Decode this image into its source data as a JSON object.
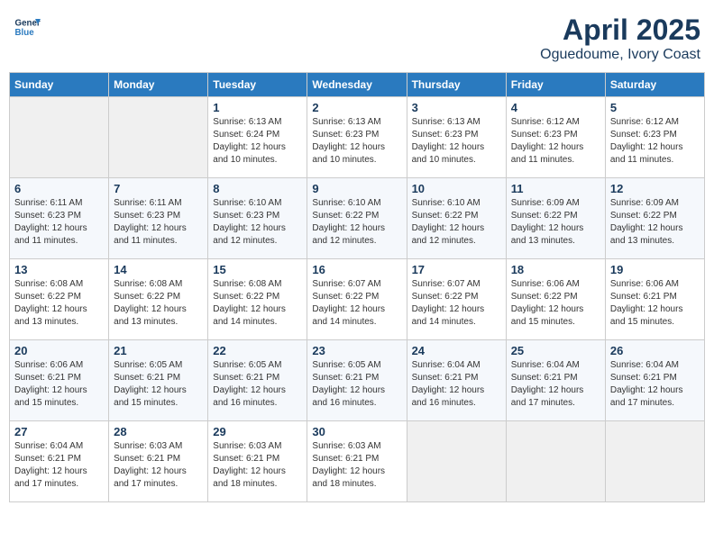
{
  "header": {
    "logo_line1": "General",
    "logo_line2": "Blue",
    "month": "April 2025",
    "location": "Oguedoume, Ivory Coast"
  },
  "weekdays": [
    "Sunday",
    "Monday",
    "Tuesday",
    "Wednesday",
    "Thursday",
    "Friday",
    "Saturday"
  ],
  "weeks": [
    [
      {
        "num": "",
        "sunrise": "",
        "sunset": "",
        "daylight": "",
        "empty": true
      },
      {
        "num": "",
        "sunrise": "",
        "sunset": "",
        "daylight": "",
        "empty": true
      },
      {
        "num": "1",
        "sunrise": "Sunrise: 6:13 AM",
        "sunset": "Sunset: 6:24 PM",
        "daylight": "Daylight: 12 hours and 10 minutes."
      },
      {
        "num": "2",
        "sunrise": "Sunrise: 6:13 AM",
        "sunset": "Sunset: 6:23 PM",
        "daylight": "Daylight: 12 hours and 10 minutes."
      },
      {
        "num": "3",
        "sunrise": "Sunrise: 6:13 AM",
        "sunset": "Sunset: 6:23 PM",
        "daylight": "Daylight: 12 hours and 10 minutes."
      },
      {
        "num": "4",
        "sunrise": "Sunrise: 6:12 AM",
        "sunset": "Sunset: 6:23 PM",
        "daylight": "Daylight: 12 hours and 11 minutes."
      },
      {
        "num": "5",
        "sunrise": "Sunrise: 6:12 AM",
        "sunset": "Sunset: 6:23 PM",
        "daylight": "Daylight: 12 hours and 11 minutes."
      }
    ],
    [
      {
        "num": "6",
        "sunrise": "Sunrise: 6:11 AM",
        "sunset": "Sunset: 6:23 PM",
        "daylight": "Daylight: 12 hours and 11 minutes."
      },
      {
        "num": "7",
        "sunrise": "Sunrise: 6:11 AM",
        "sunset": "Sunset: 6:23 PM",
        "daylight": "Daylight: 12 hours and 11 minutes."
      },
      {
        "num": "8",
        "sunrise": "Sunrise: 6:10 AM",
        "sunset": "Sunset: 6:23 PM",
        "daylight": "Daylight: 12 hours and 12 minutes."
      },
      {
        "num": "9",
        "sunrise": "Sunrise: 6:10 AM",
        "sunset": "Sunset: 6:22 PM",
        "daylight": "Daylight: 12 hours and 12 minutes."
      },
      {
        "num": "10",
        "sunrise": "Sunrise: 6:10 AM",
        "sunset": "Sunset: 6:22 PM",
        "daylight": "Daylight: 12 hours and 12 minutes."
      },
      {
        "num": "11",
        "sunrise": "Sunrise: 6:09 AM",
        "sunset": "Sunset: 6:22 PM",
        "daylight": "Daylight: 12 hours and 13 minutes."
      },
      {
        "num": "12",
        "sunrise": "Sunrise: 6:09 AM",
        "sunset": "Sunset: 6:22 PM",
        "daylight": "Daylight: 12 hours and 13 minutes."
      }
    ],
    [
      {
        "num": "13",
        "sunrise": "Sunrise: 6:08 AM",
        "sunset": "Sunset: 6:22 PM",
        "daylight": "Daylight: 12 hours and 13 minutes."
      },
      {
        "num": "14",
        "sunrise": "Sunrise: 6:08 AM",
        "sunset": "Sunset: 6:22 PM",
        "daylight": "Daylight: 12 hours and 13 minutes."
      },
      {
        "num": "15",
        "sunrise": "Sunrise: 6:08 AM",
        "sunset": "Sunset: 6:22 PM",
        "daylight": "Daylight: 12 hours and 14 minutes."
      },
      {
        "num": "16",
        "sunrise": "Sunrise: 6:07 AM",
        "sunset": "Sunset: 6:22 PM",
        "daylight": "Daylight: 12 hours and 14 minutes."
      },
      {
        "num": "17",
        "sunrise": "Sunrise: 6:07 AM",
        "sunset": "Sunset: 6:22 PM",
        "daylight": "Daylight: 12 hours and 14 minutes."
      },
      {
        "num": "18",
        "sunrise": "Sunrise: 6:06 AM",
        "sunset": "Sunset: 6:22 PM",
        "daylight": "Daylight: 12 hours and 15 minutes."
      },
      {
        "num": "19",
        "sunrise": "Sunrise: 6:06 AM",
        "sunset": "Sunset: 6:21 PM",
        "daylight": "Daylight: 12 hours and 15 minutes."
      }
    ],
    [
      {
        "num": "20",
        "sunrise": "Sunrise: 6:06 AM",
        "sunset": "Sunset: 6:21 PM",
        "daylight": "Daylight: 12 hours and 15 minutes."
      },
      {
        "num": "21",
        "sunrise": "Sunrise: 6:05 AM",
        "sunset": "Sunset: 6:21 PM",
        "daylight": "Daylight: 12 hours and 15 minutes."
      },
      {
        "num": "22",
        "sunrise": "Sunrise: 6:05 AM",
        "sunset": "Sunset: 6:21 PM",
        "daylight": "Daylight: 12 hours and 16 minutes."
      },
      {
        "num": "23",
        "sunrise": "Sunrise: 6:05 AM",
        "sunset": "Sunset: 6:21 PM",
        "daylight": "Daylight: 12 hours and 16 minutes."
      },
      {
        "num": "24",
        "sunrise": "Sunrise: 6:04 AM",
        "sunset": "Sunset: 6:21 PM",
        "daylight": "Daylight: 12 hours and 16 minutes."
      },
      {
        "num": "25",
        "sunrise": "Sunrise: 6:04 AM",
        "sunset": "Sunset: 6:21 PM",
        "daylight": "Daylight: 12 hours and 17 minutes."
      },
      {
        "num": "26",
        "sunrise": "Sunrise: 6:04 AM",
        "sunset": "Sunset: 6:21 PM",
        "daylight": "Daylight: 12 hours and 17 minutes."
      }
    ],
    [
      {
        "num": "27",
        "sunrise": "Sunrise: 6:04 AM",
        "sunset": "Sunset: 6:21 PM",
        "daylight": "Daylight: 12 hours and 17 minutes."
      },
      {
        "num": "28",
        "sunrise": "Sunrise: 6:03 AM",
        "sunset": "Sunset: 6:21 PM",
        "daylight": "Daylight: 12 hours and 17 minutes."
      },
      {
        "num": "29",
        "sunrise": "Sunrise: 6:03 AM",
        "sunset": "Sunset: 6:21 PM",
        "daylight": "Daylight: 12 hours and 18 minutes."
      },
      {
        "num": "30",
        "sunrise": "Sunrise: 6:03 AM",
        "sunset": "Sunset: 6:21 PM",
        "daylight": "Daylight: 12 hours and 18 minutes."
      },
      {
        "num": "",
        "sunrise": "",
        "sunset": "",
        "daylight": "",
        "empty": true
      },
      {
        "num": "",
        "sunrise": "",
        "sunset": "",
        "daylight": "",
        "empty": true
      },
      {
        "num": "",
        "sunrise": "",
        "sunset": "",
        "daylight": "",
        "empty": true
      }
    ]
  ]
}
